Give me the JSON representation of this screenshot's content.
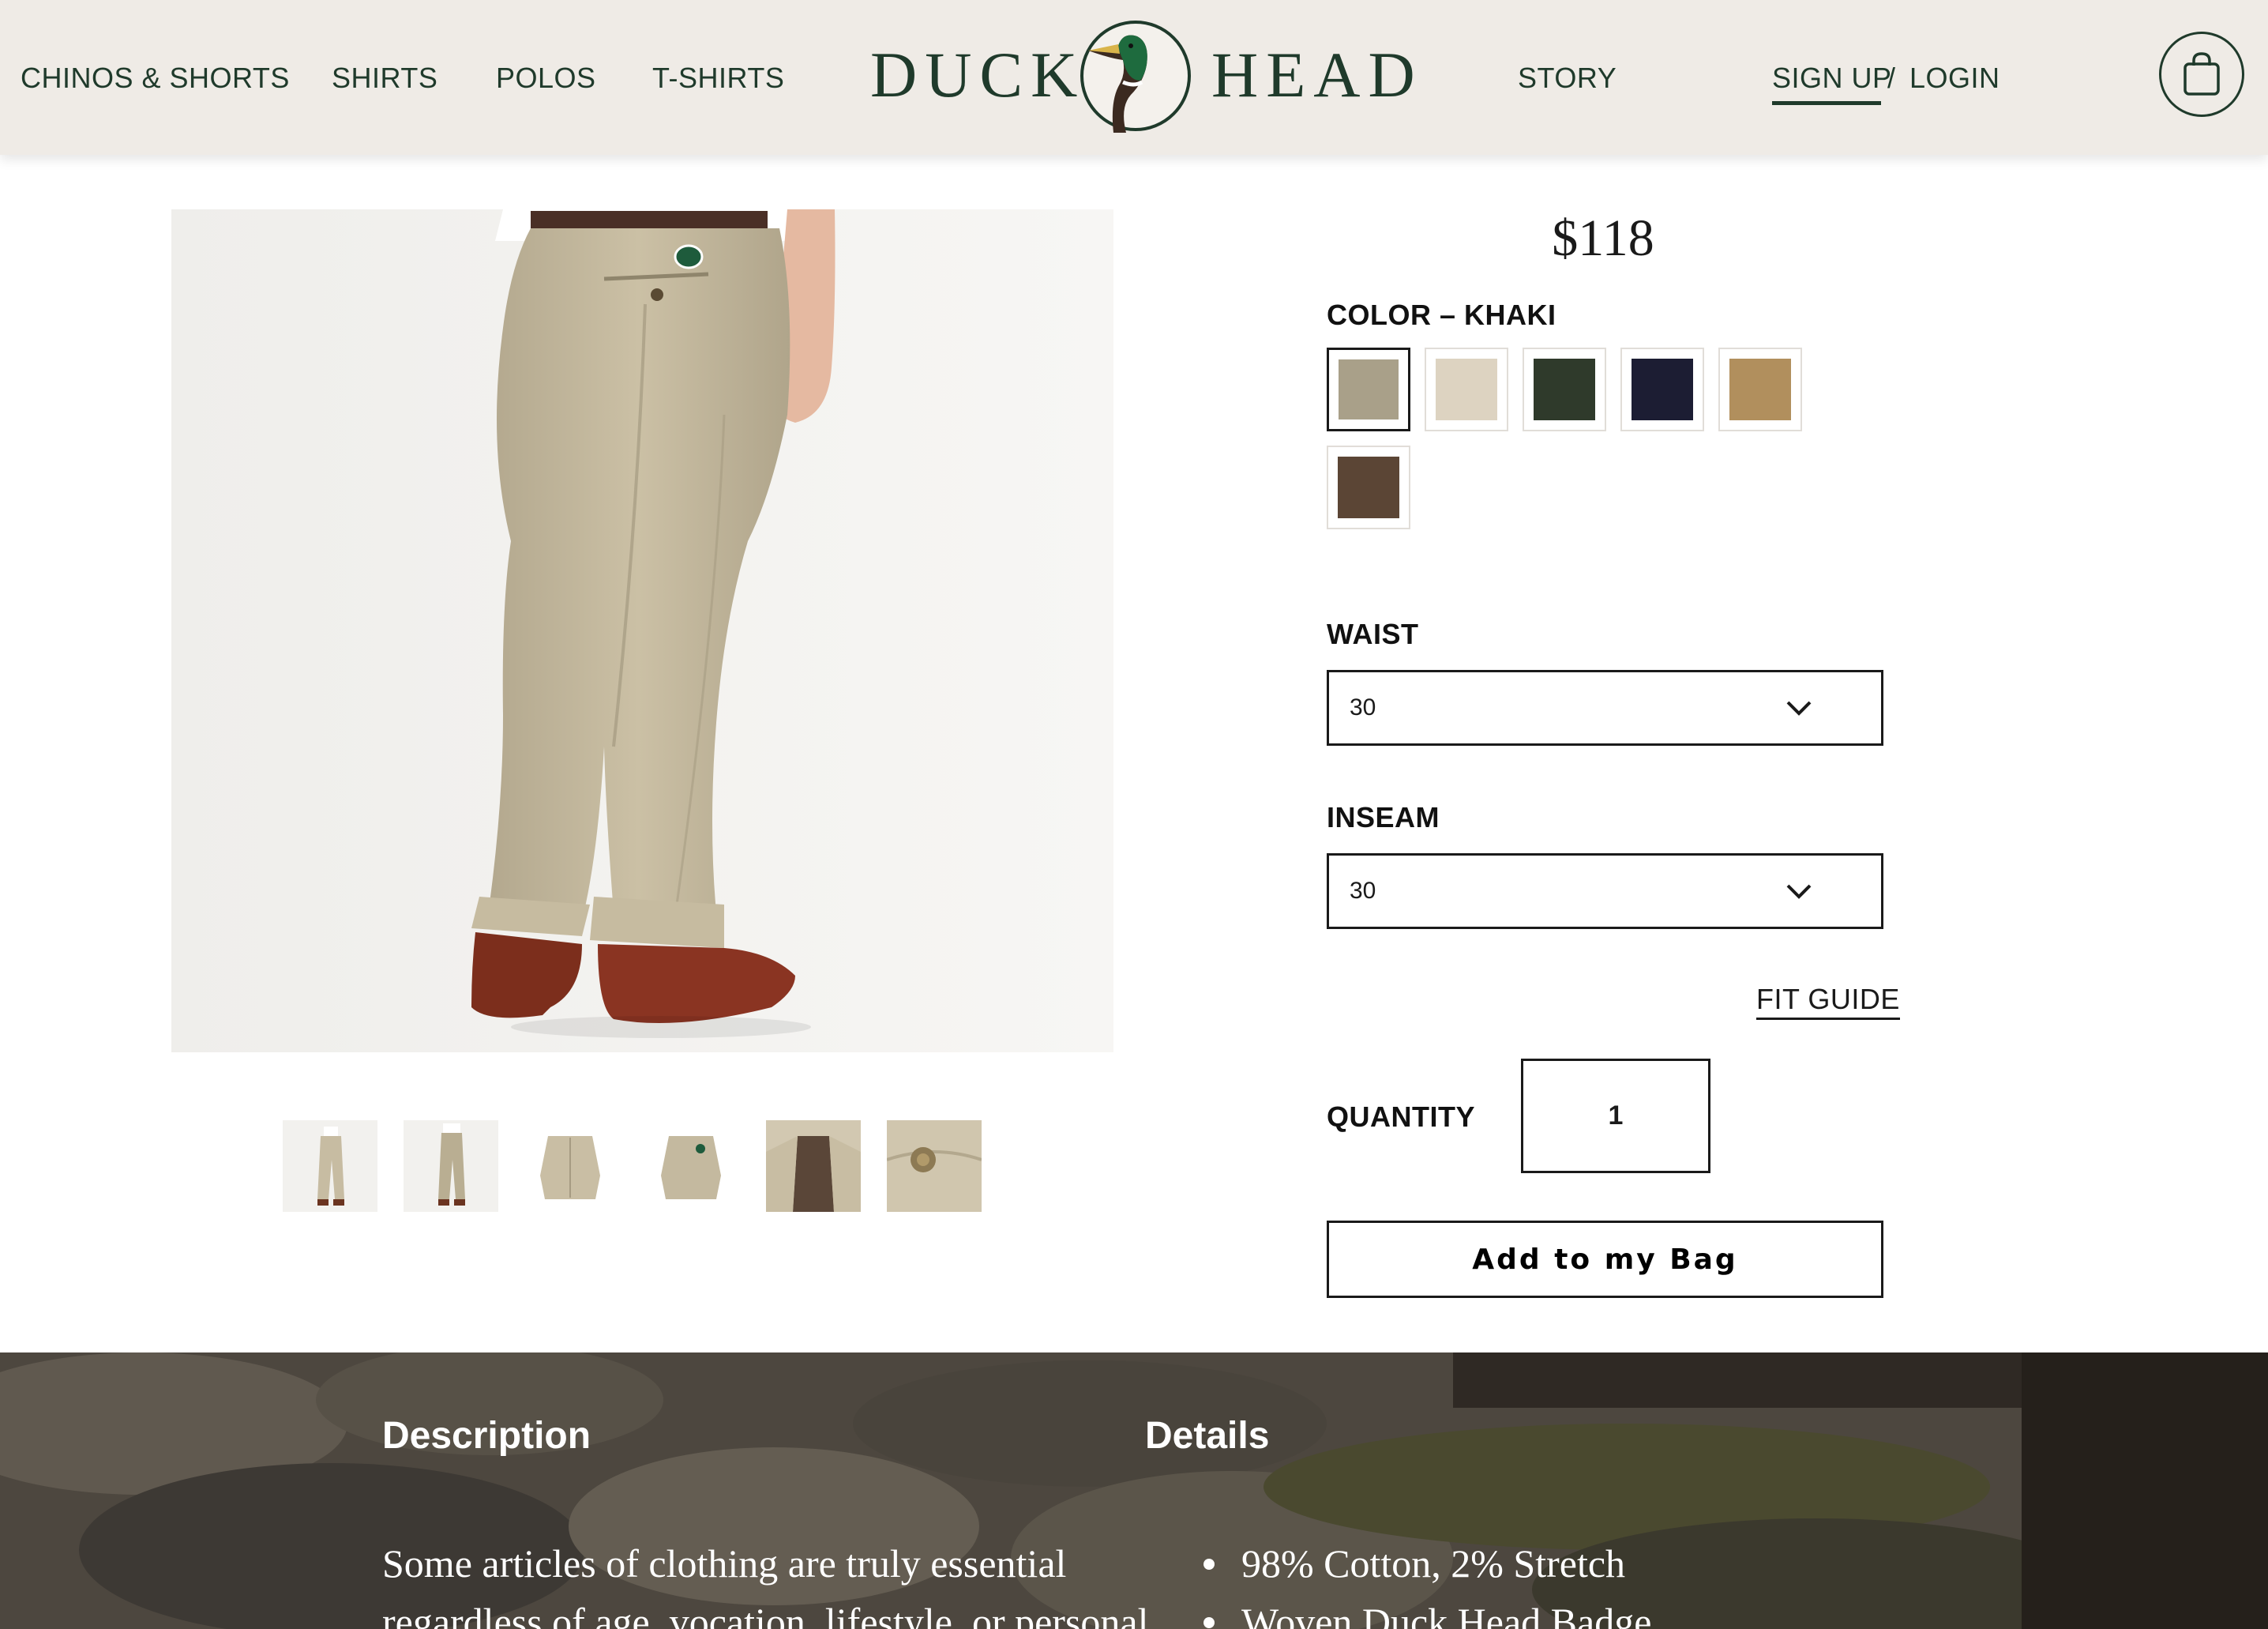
{
  "header": {
    "nav_left": [
      "CHINOS & SHORTS",
      "SHIRTS",
      "POLOS",
      "T-SHIRTS"
    ],
    "logo_left": "DUCK",
    "logo_right": "HEAD",
    "nav_story": "STORY",
    "signup_label": "SIGN UP",
    "auth_separator": "/",
    "login_label": "LOGIN",
    "cart_icon": "shopping-bag-icon"
  },
  "product": {
    "price": "$118",
    "color_label": "COLOR – KHAKI",
    "swatches": [
      {
        "name": "khaki",
        "color": "#a9a089",
        "selected": true
      },
      {
        "name": "stone",
        "color": "#ddd3c1",
        "selected": false
      },
      {
        "name": "olive",
        "color": "#2f3a2b",
        "selected": false
      },
      {
        "name": "navy",
        "color": "#1c1d33",
        "selected": false
      },
      {
        "name": "tan",
        "color": "#b18f5d",
        "selected": false
      },
      {
        "name": "brown",
        "color": "#5b4535",
        "selected": false
      }
    ],
    "waist_label": "WAIST",
    "waist_value": "30",
    "inseam_label": "INSEAM",
    "inseam_value": "30",
    "fit_guide": "FIT GUIDE",
    "quantity_label": "QUANTITY",
    "quantity_value": "1",
    "add_button": "Add to my Bag"
  },
  "description": {
    "heading": "Description",
    "text_line1": "Some articles of clothing are truly essential",
    "text_line2": "regardless of age, vocation, lifestyle, or personal"
  },
  "details": {
    "heading": "Details",
    "items": [
      "98% Cotton, 2% Stretch",
      "Woven Duck Head Badge"
    ]
  },
  "colors": {
    "brand_green": "#1f3a2b",
    "header_bg": "#efebe6"
  }
}
